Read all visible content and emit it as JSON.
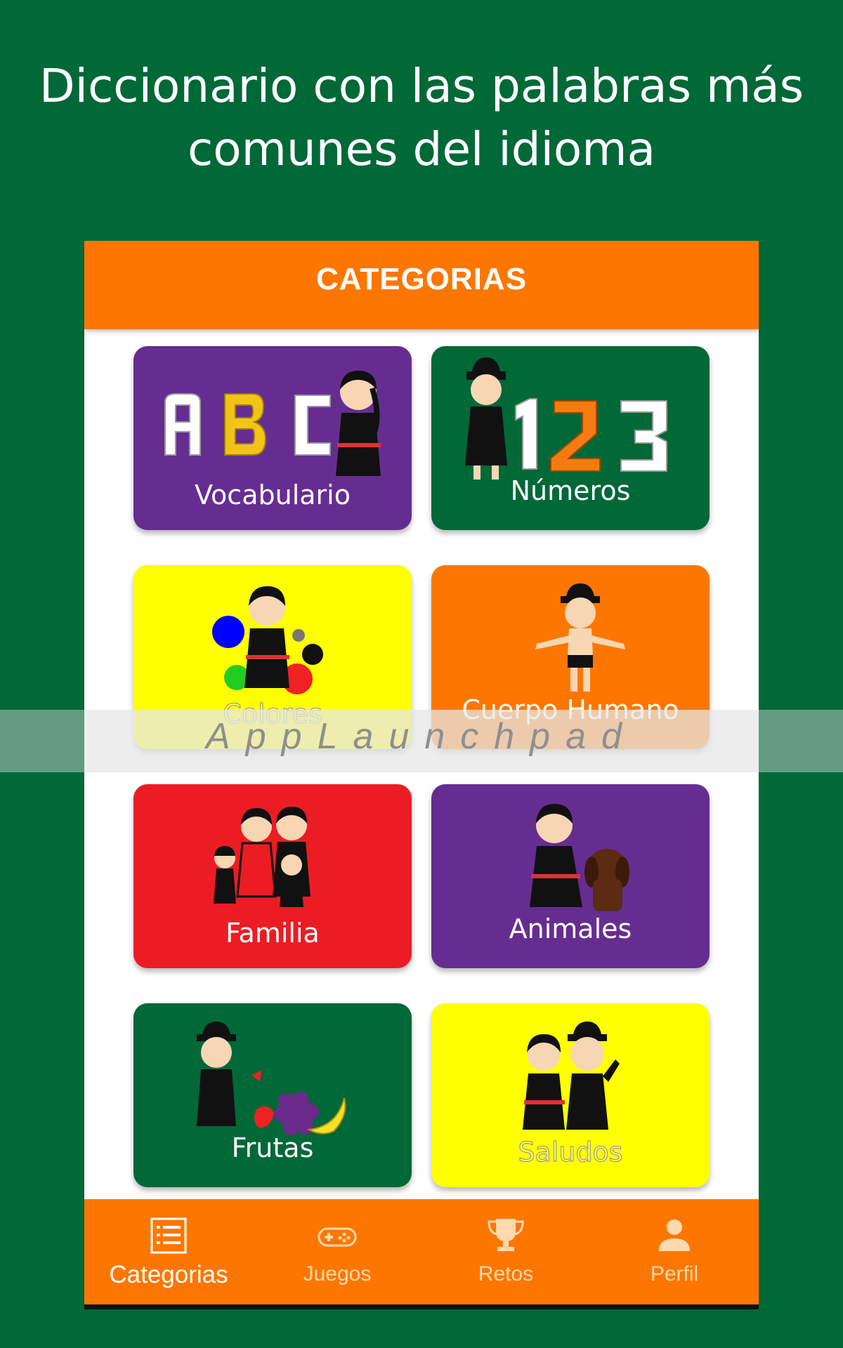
{
  "headline": {
    "line1": "Diccionario con las palabras más",
    "line2": "comunes del idioma"
  },
  "app": {
    "title": "CATEGORIAS"
  },
  "categories": [
    {
      "label": "Vocabulario",
      "color": "#662d91"
    },
    {
      "label": "Números",
      "color": "#016837"
    },
    {
      "label": "Colores",
      "color": "#ffff00"
    },
    {
      "label": "Cuerpo Humano",
      "color": "#fd7700"
    },
    {
      "label": "Familia",
      "color": "#ec1c24"
    },
    {
      "label": "Animales",
      "color": "#662d91"
    },
    {
      "label": "Frutas",
      "color": "#016837"
    },
    {
      "label": "Saludos",
      "color": "#ffff00"
    }
  ],
  "nav": {
    "items": [
      {
        "label": "Categorias",
        "icon": "list-icon",
        "active": true
      },
      {
        "label": "Juegos",
        "icon": "gamepad-icon",
        "active": false
      },
      {
        "label": "Retos",
        "icon": "trophy-icon",
        "active": false
      },
      {
        "label": "Perfil",
        "icon": "person-icon",
        "active": false
      }
    ]
  },
  "watermark": {
    "text": "AppLaunchpad"
  },
  "colors": {
    "background": "#016837",
    "accent": "#fd7700"
  }
}
